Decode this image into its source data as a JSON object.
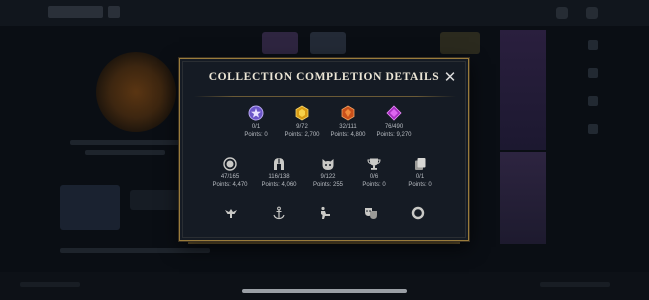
{
  "modal": {
    "title": "COLLECTION COMPLETION DETAILS",
    "close_icon": "close-icon",
    "row1": [
      {
        "icon": "purple-star-gem-icon",
        "progress": "0/1",
        "points": "Points: 0",
        "color": "#8f7be0"
      },
      {
        "icon": "gold-gem-icon",
        "progress": "9/72",
        "points": "Points: 2,700",
        "color": "#e8b020"
      },
      {
        "icon": "orange-gem-icon",
        "progress": "32/111",
        "points": "Points: 4,800",
        "color": "#e0651e"
      },
      {
        "icon": "magenta-gem-icon",
        "progress": "76/490",
        "points": "Points: 9,270",
        "color": "#c043d8"
      }
    ],
    "row2": [
      {
        "icon": "ring-medal-icon",
        "progress": "47/165",
        "points": "Points: 4,470"
      },
      {
        "icon": "helmet-icon",
        "progress": "116/138",
        "points": "Points: 4,060"
      },
      {
        "icon": "cat-face-icon",
        "progress": "9/122",
        "points": "Points: 255"
      },
      {
        "icon": "trophy-icon",
        "progress": "0/6",
        "points": "Points: 0"
      },
      {
        "icon": "cards-icon",
        "progress": "0/1",
        "points": "Points: 0"
      }
    ],
    "row3_icons": [
      "winged-emblem-icon",
      "anchor-icon",
      "figure-icon",
      "masks-icon",
      "ring-icon"
    ]
  },
  "colors": {
    "border_gold": "#9a7c3c",
    "modal_bg": "#151b24",
    "text": "#b8bcc2",
    "icon_gray": "#c9c9c6"
  }
}
